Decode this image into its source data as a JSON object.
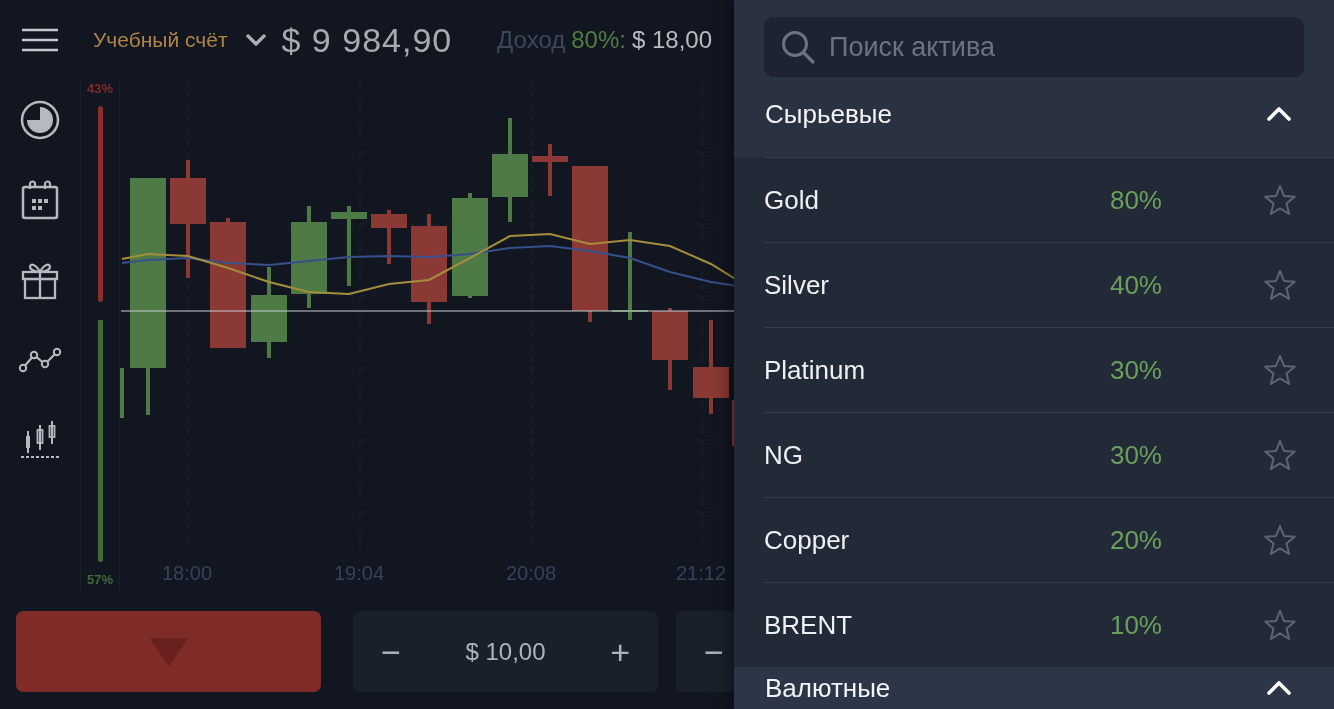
{
  "top_bar": {
    "account_label": "Учебный счёт",
    "balance": "$ 9 984,90",
    "income": {
      "label": "Доход",
      "percent": "80%:",
      "amount": "$ 18,00"
    }
  },
  "chart": {
    "gauge": {
      "top_label": "43%",
      "bottom_label": "57%",
      "level": 0.43
    },
    "time_labels": [
      "18:00",
      "19:04",
      "20:08",
      "21:12"
    ]
  },
  "trade_bar": {
    "steppers": [
      {
        "decrement": "−",
        "value": "$ 10,00",
        "increment": "+"
      },
      {
        "decrement": "−"
      }
    ]
  },
  "asset_panel": {
    "search": {
      "placeholder": "Поиск актива"
    },
    "sections": [
      {
        "title": "Сырьевые",
        "expanded": true,
        "assets": [
          {
            "name": "Gold",
            "payout": "80%",
            "favorite": false
          },
          {
            "name": "Silver",
            "payout": "40%",
            "favorite": false
          },
          {
            "name": "Platinum",
            "payout": "30%",
            "favorite": false
          },
          {
            "name": "NG",
            "payout": "30%",
            "favorite": false
          },
          {
            "name": "Copper",
            "payout": "20%",
            "favorite": false
          },
          {
            "name": "BRENT",
            "payout": "10%",
            "favorite": false
          }
        ]
      },
      {
        "title": "Валютные",
        "expanded": true
      }
    ]
  }
}
